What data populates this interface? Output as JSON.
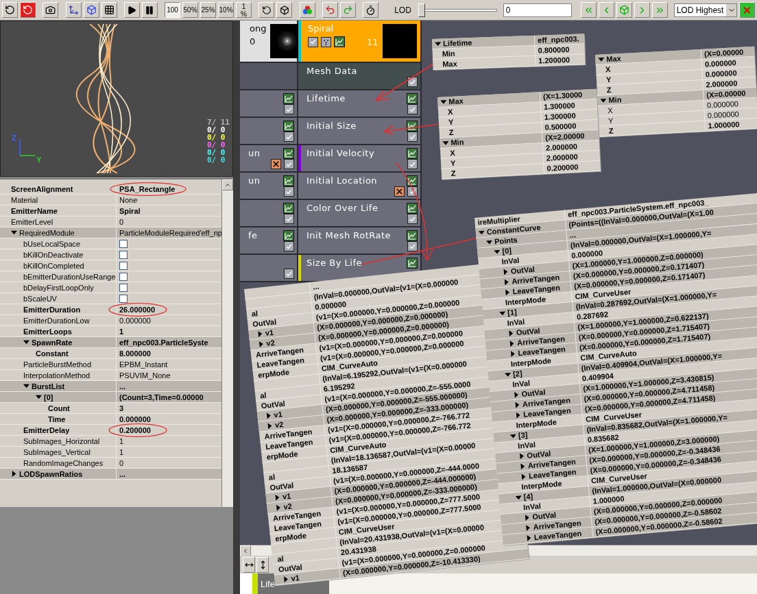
{
  "toolbar": {
    "zoom_buttons": [
      {
        "label": "100",
        "selected": true
      },
      {
        "label": "50%",
        "selected": false
      },
      {
        "label": "25%",
        "selected": false
      },
      {
        "label": "10%",
        "selected": false
      },
      {
        "label": "1 %",
        "selected": false
      }
    ],
    "lod": {
      "label": "LOD",
      "level": 0,
      "value": "0",
      "select": "LOD Highest"
    }
  },
  "preview": {
    "axes": [
      {
        "label": "Z",
        "color": "#4060ff"
      },
      {
        "label": "Y",
        "color": "#30d030"
      }
    ],
    "stats": [
      {
        "text": "7/ 11",
        "color": "#b8b8b8"
      },
      {
        "text": "0/ 0",
        "color": "#ffffff"
      },
      {
        "text": "0/ 0",
        "color": "#ffff40"
      },
      {
        "text": "0/ 0",
        "color": "#ff60ff"
      },
      {
        "text": "0/ 0",
        "color": "#40ffff"
      },
      {
        "text": "0/ 0",
        "color": "#40e0e0"
      }
    ]
  },
  "properties": [
    {
      "name": "ScreenAlignment",
      "value": "PSA_Rectangle",
      "bold": true
    },
    {
      "name": "Material",
      "value": "None",
      "bold": false
    },
    {
      "name": "EmitterName",
      "value": "Spiral",
      "bold": true
    },
    {
      "name": "EmitterLevel",
      "value": "0",
      "bold": false
    },
    {
      "name": "RequiredModule",
      "value": "ParticleModuleRequired'eff_np",
      "bold": false,
      "expanded": true,
      "children": [
        {
          "name": "bUseLocalSpace",
          "kind": "checkbox",
          "checked": false,
          "bold": false
        },
        {
          "name": "bKillOnDeactivate",
          "kind": "checkbox",
          "checked": false,
          "bold": false
        },
        {
          "name": "bKillOnCompleted",
          "kind": "checkbox",
          "checked": false,
          "bold": false
        },
        {
          "name": "bEmitterDurationUseRange",
          "kind": "checkbox",
          "checked": false,
          "bold": false
        },
        {
          "name": "bDelayFirstLoopOnly",
          "kind": "checkbox",
          "checked": false,
          "bold": false
        },
        {
          "name": "bScaleUV",
          "kind": "checkbox",
          "checked": false,
          "bold": false
        },
        {
          "name": "EmitterDuration",
          "value": "26.000000",
          "bold": true
        },
        {
          "name": "EmitterDurationLow",
          "value": "0.000000",
          "bold": false
        },
        {
          "name": "EmitterLoops",
          "value": "1",
          "bold": true
        },
        {
          "name": "SpawnRate",
          "value": "eff_npc003.ParticleSyste",
          "bold": true,
          "expanded": true,
          "children": [
            {
              "name": "Constant",
              "value": "8.000000",
              "bold": true
            }
          ]
        },
        {
          "name": "ParticleBurstMethod",
          "value": "EPBM_Instant",
          "bold": false
        },
        {
          "name": "InterpolationMethod",
          "value": "PSUVIM_None",
          "bold": false
        },
        {
          "name": "BurstList",
          "value": "...",
          "bold": true,
          "expanded": true,
          "children": [
            {
              "name": "[0]",
              "value": "(Count=3,Time=0.00000",
              "bold": true,
              "expanded": true,
              "children": [
                {
                  "name": "Count",
                  "value": "3",
                  "bold": true
                },
                {
                  "name": "Time",
                  "value": "0.000000",
                  "bold": true
                }
              ]
            }
          ]
        },
        {
          "name": "EmitterDelay",
          "value": "0.200000",
          "bold": true
        },
        {
          "name": "SubImages_Horizontal",
          "value": "1",
          "bold": false
        },
        {
          "name": "SubImages_Vertical",
          "value": "1",
          "bold": false
        },
        {
          "name": "RandomImageChanges",
          "value": "0",
          "bold": false
        }
      ]
    },
    {
      "name": "LODSpawnRatios",
      "value": "...",
      "bold": true,
      "expanded": false
    }
  ],
  "emitters": [
    {
      "title": "ong",
      "count": "0",
      "selected": false,
      "modules": [
        {
          "kind": "blank"
        },
        {
          "kind": "module",
          "curve": true,
          "checked": true
        },
        {
          "kind": "module",
          "curve": true,
          "checked": true
        },
        {
          "kind": "module",
          "label": "un",
          "curve": true,
          "checked": true,
          "marked": true
        },
        {
          "kind": "module",
          "label": "un",
          "curve": true,
          "checked": true
        },
        {
          "kind": "module",
          "curve": true,
          "checked": true
        },
        {
          "kind": "module",
          "label": "fe",
          "curve": true,
          "checked": true
        },
        {
          "kind": "module",
          "curve": false,
          "checked": true
        }
      ]
    },
    {
      "title": "Spiral",
      "count": "11",
      "selected": true,
      "color": "#00c8d0",
      "modules": [
        {
          "kind": "data",
          "label": "Mesh Data",
          "checked": true
        },
        {
          "kind": "module",
          "label": "Lifetime",
          "curve": true,
          "checked": true
        },
        {
          "kind": "module",
          "label": "Initial Size",
          "curve": true,
          "checked": true
        },
        {
          "kind": "module",
          "label": "Initial Velocity",
          "curve": true,
          "checked": true,
          "color": "#8000e0"
        },
        {
          "kind": "module",
          "label": "Initial Location",
          "curve": true,
          "checked": true,
          "marked": true
        },
        {
          "kind": "module",
          "label": "Color Over Life",
          "curve": true,
          "checked": true
        },
        {
          "kind": "module",
          "label": "Init Mesh RotRate",
          "curve": true,
          "checked": true
        },
        {
          "kind": "module",
          "label": "Size By Life",
          "curve": true,
          "color": "#d8d800"
        }
      ]
    }
  ],
  "panels": [
    {
      "rows": [
        {
          "name": "Lifetime",
          "value": "eff_npc003.",
          "bold": true,
          "expanded": true,
          "children": [
            {
              "name": "Min",
              "value": "0.800000",
              "bold": true
            },
            {
              "name": "Max",
              "value": "1.200000",
              "bold": true
            }
          ]
        }
      ]
    },
    {
      "rows": [
        {
          "name": "Max",
          "value": "(X=1.30000",
          "bold": true,
          "expanded": true,
          "children": [
            {
              "name": "X",
              "value": "1.300000",
              "bold": true
            },
            {
              "name": "Y",
              "value": "1.300000",
              "bold": true
            },
            {
              "name": "Z",
              "value": "0.500000",
              "bold": true
            }
          ]
        },
        {
          "name": "Min",
          "value": "(X=2.00000",
          "bold": true,
          "expanded": true,
          "children": [
            {
              "name": "X",
              "value": "2.000000",
              "bold": true
            },
            {
              "name": "Y",
              "value": "2.000000",
              "bold": true
            },
            {
              "name": "Z",
              "value": "0.200000",
              "bold": true
            }
          ]
        }
      ]
    },
    {
      "rows": [
        {
          "name": "Max",
          "value": "(X=0.00000",
          "bold": true,
          "expanded": true,
          "children": [
            {
              "name": "X",
              "value": "0.000000",
              "bold": true
            },
            {
              "name": "Y",
              "value": "0.000000",
              "bold": true
            },
            {
              "name": "Z",
              "value": "2.000000",
              "bold": true
            }
          ]
        },
        {
          "name": "Min",
          "value": "(X=0.00000",
          "bold": true,
          "expanded": true,
          "children": [
            {
              "name": "X",
              "value": "0.000000",
              "bold": false
            },
            {
              "name": "Y",
              "value": "0.000000",
              "bold": false
            },
            {
              "name": "Z",
              "value": "1.000000",
              "bold": true
            }
          ]
        }
      ]
    },
    {
      "rows": [
        {
          "name": "ireMultiplier",
          "value": "eff_npc003.ParticleSystem.eff_npc003_",
          "bold": true
        },
        {
          "name": "ConstantCurve",
          "value": "(Points=((InVal=0.000000,OutVal=(X=1.00",
          "bold": true,
          "expanded": true,
          "children": [
            {
              "name": "Points",
              "value": "...",
              "bold": true,
              "expanded": true,
              "children": [
                {
                  "name": "[0]",
                  "value": "(InVal=0.000000,OutVal=(X=1.000000,Y=",
                  "bold": true,
                  "expanded": true,
                  "children": [
                    {
                      "name": "InVal",
                      "value": "0.000000",
                      "bold": true
                    },
                    {
                      "name": "OutVal",
                      "value": "(X=1.000000,Y=1.000000,Z=0.000000)",
                      "bold": true,
                      "expanded": false
                    },
                    {
                      "name": "ArriveTangen",
                      "value": "(X=0.000000,Y=0.000000,Z=0.171407)",
                      "bold": true,
                      "expanded": false
                    },
                    {
                      "name": "LeaveTangen",
                      "value": "(X=0.000000,Y=0.000000,Z=0.171407)",
                      "bold": true,
                      "expanded": false
                    },
                    {
                      "name": "InterpMode",
                      "value": "CIM_CurveUser",
                      "bold": true
                    }
                  ]
                },
                {
                  "name": "[1]",
                  "value": "(InVal=0.287692,OutVal=(X=1.000000,Y=",
                  "bold": true,
                  "expanded": true,
                  "children": [
                    {
                      "name": "InVal",
                      "value": "0.287692",
                      "bold": true
                    },
                    {
                      "name": "OutVal",
                      "value": "(X=1.000000,Y=1.000000,Z=0.622137)",
                      "bold": true,
                      "expanded": false
                    },
                    {
                      "name": "ArriveTangen",
                      "value": "(X=0.000000,Y=0.000000,Z=1.715407)",
                      "bold": true,
                      "expanded": false
                    },
                    {
                      "name": "LeaveTangen",
                      "value": "(X=0.000000,Y=0.000000,Z=1.715407)",
                      "bold": true,
                      "expanded": false
                    },
                    {
                      "name": "InterpMode",
                      "value": "CIM_CurveAuto",
                      "bold": true
                    }
                  ]
                },
                {
                  "name": "[2]",
                  "value": "(InVal=0.409904,OutVal=(X=1.000000,Y=",
                  "bold": true,
                  "expanded": true,
                  "children": [
                    {
                      "name": "InVal",
                      "value": "0.409904",
                      "bold": true
                    },
                    {
                      "name": "OutVal",
                      "value": "(X=1.000000,Y=1.000000,Z=3.430815)",
                      "bold": true,
                      "expanded": false
                    },
                    {
                      "name": "ArriveTangen",
                      "value": "(X=0.000000,Y=0.000000,Z=4.711458)",
                      "bold": true,
                      "expanded": false
                    },
                    {
                      "name": "LeaveTangen",
                      "value": "(X=0.000000,Y=0.000000,Z=4.711458)",
                      "bold": true,
                      "expanded": false
                    },
                    {
                      "name": "InterpMode",
                      "value": "CIM_CurveUser",
                      "bold": true
                    }
                  ]
                },
                {
                  "name": "[3]",
                  "value": "(InVal=0.835682,OutVal=(X=1.000000,Y=",
                  "bold": true,
                  "expanded": true,
                  "children": [
                    {
                      "name": "InVal",
                      "value": "0.835682",
                      "bold": true
                    },
                    {
                      "name": "OutVal",
                      "value": "(X=1.000000,Y=1.000000,Z=3.000000)",
                      "bold": true,
                      "expanded": false
                    },
                    {
                      "name": "ArriveTangen",
                      "value": "(X=0.000000,Y=0.000000,Z=-0.348436",
                      "bold": true,
                      "expanded": false
                    },
                    {
                      "name": "LeaveTangen",
                      "value": "(X=0.000000,Y=0.000000,Z=-0.348436",
                      "bold": true,
                      "expanded": false
                    },
                    {
                      "name": "InterpMode",
                      "value": "CIM_CurveUser",
                      "bold": true
                    }
                  ]
                },
                {
                  "name": "[4]",
                  "value": "(InVal=1.000000,OutVal=(X=0.000000",
                  "bold": true,
                  "expanded": true,
                  "children": [
                    {
                      "name": "InVal",
                      "value": "1.000000",
                      "bold": true
                    },
                    {
                      "name": "OutVal",
                      "value": "(X=0.000000,Y=0.000000,Z=0.000000",
                      "bold": true,
                      "expanded": false
                    },
                    {
                      "name": "ArriveTangen",
                      "value": "(X=0.000000,Y=0.000000,Z=-0.58602",
                      "bold": true,
                      "expanded": false
                    },
                    {
                      "name": "LeaveTangen",
                      "value": "(X=0.000000,Y=0.000000,Z=-0.58602",
                      "bold": true,
                      "expanded": false
                    }
                  ]
                }
              ]
            }
          ]
        }
      ]
    },
    {
      "rows": [
        {
          "value": "...",
          "bold": true
        },
        {
          "value": "(InVal=0.000000,OutVal=(v1=(X=0.000000",
          "bold": true,
          "children": [
            {
              "name": "al",
              "value": "0.000000",
              "bold": true
            },
            {
              "name": "OutVal",
              "value": "(v1=(X=0.000000,Y=0.000000,Z=0.000000",
              "bold": true,
              "children": [
                {
                  "name": "v1",
                  "value": "(X=0.000000,Y=0.000000,Z=0.000000)",
                  "bold": true,
                  "expanded": false
                },
                {
                  "name": "v2",
                  "value": "(X=0.000000,Y=0.000000,Z=0.000000)",
                  "bold": true,
                  "expanded": false
                }
              ]
            },
            {
              "name": "ArriveTangen",
              "value": "(v1=(X=0.000000,Y=0.000000,Z=0.000000",
              "bold": true
            },
            {
              "name": "LeaveTangen",
              "value": "(v1=(X=0.000000,Y=0.000000,Z=0.000000",
              "bold": true
            },
            {
              "name": "erpMode",
              "value": "CIM_CurveAuto",
              "bold": true
            }
          ]
        },
        {
          "value": "(InVal=6.195292,OutVal=(v1=(X=0.000000",
          "bold": true,
          "children": [
            {
              "name": "al",
              "value": "6.195292",
              "bold": true
            },
            {
              "name": "OutVal",
              "value": "(v1=(X=0.000000,Y=0.000000,Z=-555.0000",
              "bold": true,
              "children": [
                {
                  "name": "v1",
                  "value": "(X=0.000000,Y=0.000000,Z=-555.000000)",
                  "bold": true,
                  "expanded": false
                },
                {
                  "name": "v2",
                  "value": "(X=0.000000,Y=0.000000,Z=-333.000000)",
                  "bold": true,
                  "expanded": false
                }
              ]
            },
            {
              "name": "ArriveTangen",
              "value": "(v1=(X=0.000000,Y=0.000000,Z=-766.772",
              "bold": true
            },
            {
              "name": "LeaveTangen",
              "value": "(v1=(X=0.000000,Y=0.000000,Z=-766.772",
              "bold": true
            },
            {
              "name": "erpMode",
              "value": "CIM_CurveAuto",
              "bold": true
            }
          ]
        },
        {
          "value": "(InVal=18.136587,OutVal=(v1=(X=0.00000",
          "bold": true,
          "children": [
            {
              "name": "al",
              "value": "18.136587",
              "bold": true
            },
            {
              "name": "OutVal",
              "value": "(v1=(X=0.000000,Y=0.000000,Z=-444.0000",
              "bold": true,
              "children": [
                {
                  "name": "v1",
                  "value": "(X=0.000000,Y=0.000000,Z=-444.000000)",
                  "bold": true,
                  "expanded": false
                },
                {
                  "name": "v2",
                  "value": "(X=0.000000,Y=0.000000,Z=-333.000000)",
                  "bold": true,
                  "expanded": false
                }
              ]
            },
            {
              "name": "ArriveTangen",
              "value": "(v1=(X=0.000000,Y=0.000000,Z=777.5000",
              "bold": true
            },
            {
              "name": "LeaveTangen",
              "value": "(v1=(X=0.000000,Y=0.000000,Z=777.5000",
              "bold": true
            },
            {
              "name": "erpMode",
              "value": "CIM_CurveUser",
              "bold": true
            }
          ]
        },
        {
          "value": "(InVal=20.431938,OutVal=(v1=(X=0.00000",
          "bold": true,
          "children": [
            {
              "name": "al",
              "value": "20.431938",
              "bold": true
            },
            {
              "name": "OutVal",
              "value": "(v1=(X=0.000000,Y=0.000000,Z=0.000000",
              "bold": true,
              "children": [
                {
                  "name": "v1",
                  "value": "(X=0.000000,Y=0.000000,Z=-10.413330)",
                  "bold": true,
                  "expanded": false
                }
              ]
            }
          ]
        }
      ]
    }
  ],
  "curve_editor": {
    "curves": [
      {
        "label": "Life"
      }
    ]
  }
}
